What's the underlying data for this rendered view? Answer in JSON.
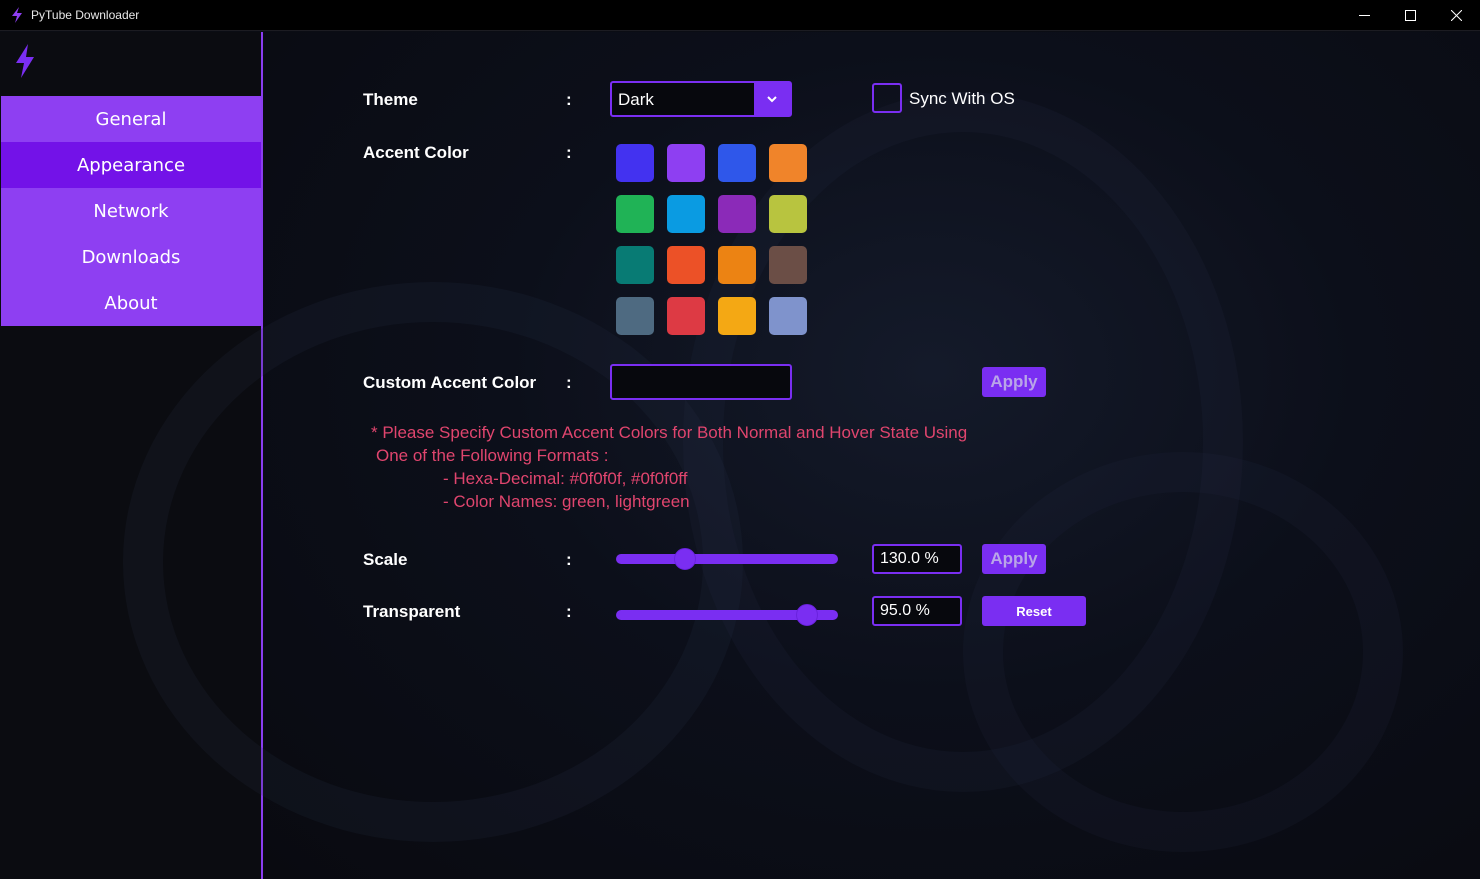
{
  "window": {
    "title": "PyTube Downloader"
  },
  "sidebar": {
    "items": [
      {
        "label": "General"
      },
      {
        "label": "Appearance",
        "active": true
      },
      {
        "label": "Network"
      },
      {
        "label": "Downloads"
      },
      {
        "label": "About"
      }
    ]
  },
  "appearance": {
    "theme": {
      "label": "Theme",
      "colon": ":",
      "selected": "Dark",
      "sync_label": "Sync With OS",
      "sync_checked": false
    },
    "accent": {
      "label": "Accent Color",
      "colon": ":",
      "colors": [
        "#4332f0",
        "#8e3ff2",
        "#2f57ea",
        "#f0842a",
        "#20b356",
        "#0a9be2",
        "#8b2ab8",
        "#b8c43f",
        "#087b74",
        "#ec5127",
        "#ec8313",
        "#6b4e46",
        "#4e6a81",
        "#dd3a44",
        "#f4a814",
        "#7f93cc"
      ]
    },
    "custom_accent": {
      "label": "Custom Accent Color",
      "colon": ":",
      "value": "",
      "apply_label": "Apply",
      "note_lines": [
        "* Please Specify Custom Accent Colors for Both Normal and Hover State Using",
        "One of the Following Formats :",
        "- Hexa-Decimal: #0f0f0f, #0f0f0ff",
        "- Color Names: green, lightgreen"
      ]
    },
    "scale": {
      "label": "Scale",
      "colon": ":",
      "value": "130.0 %",
      "slider_fraction": 0.31,
      "apply_label": "Apply"
    },
    "transparent": {
      "label": "Transparent",
      "colon": ":",
      "value": "95.0 %",
      "slider_fraction": 0.86,
      "reset_label": "Reset"
    }
  },
  "colors": {
    "accent": "#7a2ef2",
    "sidebar_bg": "#8e3ff2",
    "sidebar_active": "#7312e8",
    "note": "#e0456e"
  }
}
